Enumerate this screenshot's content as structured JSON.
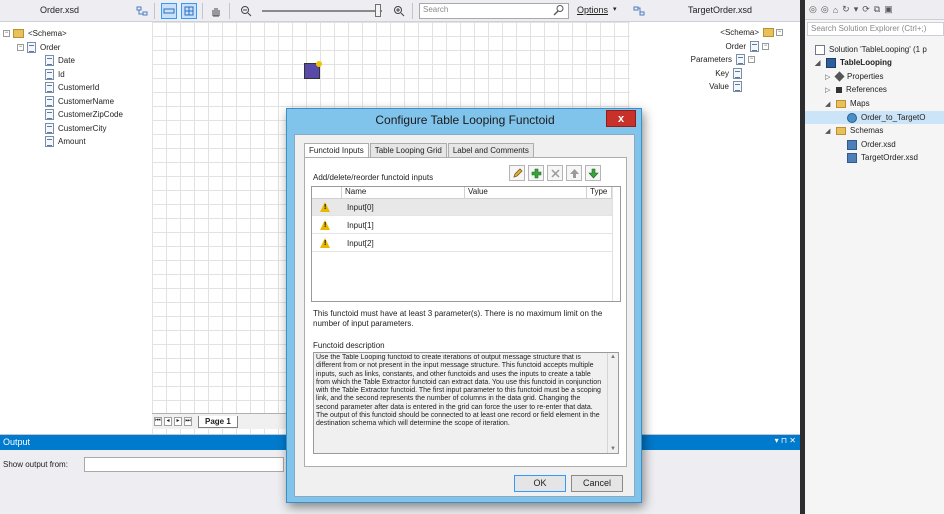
{
  "toolbar": {
    "source_schema_title": "Order.xsd",
    "target_schema_title": "TargetOrder.xsd",
    "search_placeholder": "Search",
    "options_label": "Options"
  },
  "source_tree": {
    "root": "<Schema>",
    "record": "Order",
    "fields": [
      "Date",
      "Id",
      "CustomerId",
      "CustomerName",
      "CustomerZipCode",
      "CustomerCity",
      "Amount"
    ]
  },
  "target_tree": {
    "root": "<Schema>",
    "record": "Order",
    "parameters": "Parameters",
    "key": "Key",
    "value": "Value"
  },
  "grid": {
    "page_tab": "Page 1"
  },
  "output": {
    "title": "Output",
    "controls": "▾ ⊓ ✕",
    "show_from_label": "Show output from:"
  },
  "solution_explorer": {
    "search_placeholder": "Search Solution Explorer (Ctrl+;)",
    "solution": "Solution 'TableLooping' (1 p",
    "project": "TableLooping",
    "properties": "Properties",
    "references": "References",
    "maps_folder": "Maps",
    "map_file": "Order_to_TargetO",
    "schemas_folder": "Schemas",
    "schema_files": [
      "Order.xsd",
      "TargetOrder.xsd"
    ]
  },
  "dialog": {
    "title": "Configure Table Looping Functoid",
    "close": "x",
    "tabs": [
      "Functoid Inputs",
      "Table Looping Grid",
      "Label and Comments"
    ],
    "edit_label": "Add/delete/reorder functoid inputs",
    "columns": [
      "Name",
      "Value",
      "Type"
    ],
    "inputs": [
      "Input[0]",
      "Input[1]",
      "Input[2]"
    ],
    "min_note": "This functoid must have at least 3 parameter(s). There is no maximum limit on the number of input parameters.",
    "description_label": "Functoid description",
    "description": "Use the Table Looping functoid to create iterations of output message structure that is different from or not present in the input message structure. This functoid accepts multiple inputs, such as links, constants, and other functoids and uses the inputs to create a table from which the Table Extractor functoid can extract data. You use this functoid in conjunction with the Table Extractor functoid. The first input parameter to this functoid must be a scoping link, and the second represents the number of columns in the data grid.  Changing the second parameter after data is entered in the grid can force the user to re-enter that data. The output of this functoid should be connected to at least one record or field element in the destination schema which will determine the scope of iteration.",
    "ok": "OK",
    "cancel": "Cancel"
  },
  "colors": {
    "accent": "#007acc",
    "dialog_frame": "#80c4ec",
    "close_button": "#c7312a",
    "warning": "#e8b800"
  }
}
